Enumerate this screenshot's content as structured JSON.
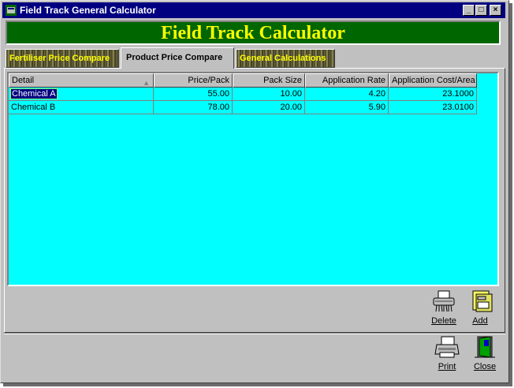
{
  "window": {
    "title": "Field Track General Calculator"
  },
  "banner": {
    "title": "Field Track Calculator",
    "color": "#006600",
    "text_color": "#ffff00"
  },
  "tabs": [
    {
      "label": "Fertiliser Price Compare",
      "active": false
    },
    {
      "label": "Product Price Compare",
      "active": true
    },
    {
      "label": "General Calculations",
      "active": false
    }
  ],
  "table": {
    "columns": [
      "Detail",
      "Price/Pack",
      "Pack Size",
      "Application Rate",
      "Application Cost/Area"
    ],
    "rows": [
      [
        "Chemical A",
        "55.00",
        "10.00",
        "4.20",
        "23.1000"
      ],
      [
        "Chemical B",
        "78.00",
        "20.00",
        "5.90",
        "23.0100"
      ]
    ],
    "selected_cell": "Chemical A",
    "background": "#00ffff"
  },
  "actions": {
    "delete_label": "Delete",
    "add_label": "Add",
    "print_label": "Print",
    "close_label": "Close"
  },
  "icons": [
    "app-icon",
    "minimize-icon",
    "maximize-icon",
    "close-window-icon",
    "shredder-icon",
    "add-doc-icon",
    "printer-icon",
    "exit-door-icon",
    "sort-ascending-icon"
  ]
}
